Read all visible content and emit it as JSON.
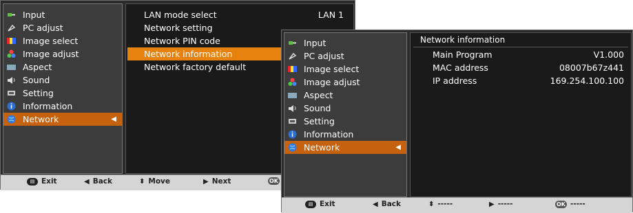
{
  "menu": {
    "items": [
      {
        "label": "Input",
        "icon": "input-icon"
      },
      {
        "label": "PC adjust",
        "icon": "pc-adjust-icon"
      },
      {
        "label": "Image select",
        "icon": "image-select-icon"
      },
      {
        "label": "Image adjust",
        "icon": "image-adjust-icon"
      },
      {
        "label": "Aspect",
        "icon": "aspect-icon"
      },
      {
        "label": "Sound",
        "icon": "sound-icon"
      },
      {
        "label": "Setting",
        "icon": "setting-icon"
      },
      {
        "label": "Information",
        "icon": "information-icon"
      },
      {
        "label": "Network",
        "icon": "network-icon"
      }
    ],
    "selected_index": 8,
    "selected_arrow": "◀"
  },
  "network_menu": {
    "items": [
      {
        "label": "LAN mode select",
        "value": "LAN 1"
      },
      {
        "label": "Network setting",
        "value": ""
      },
      {
        "label": "Network PIN code",
        "value": ""
      },
      {
        "label": "Network information",
        "value": ""
      },
      {
        "label": "Network factory default",
        "value": ""
      }
    ],
    "selected_index": 3
  },
  "network_info": {
    "title": "Network information",
    "rows": [
      {
        "label": "Main Program",
        "value": "V1.000"
      },
      {
        "label": "MAC address",
        "value": "08007b67z441"
      },
      {
        "label": "IP address",
        "value": "169.254.100.100"
      }
    ]
  },
  "footer_back": {
    "exit": "Exit",
    "back": "Back",
    "move": "Move",
    "next": "Next",
    "ok_icon": "OK"
  },
  "footer_front": {
    "exit": "Exit",
    "back": "Back",
    "move": "-----",
    "next": "-----",
    "ok": "-----",
    "ok_icon": "OK"
  },
  "colors": {
    "selected_item": "#c6610d",
    "selected_submenu": "#e8820e",
    "panel_bg": "#1a1a1a",
    "menu_bg": "#3c3c3c",
    "footer_bg": "#d5d5d5"
  }
}
